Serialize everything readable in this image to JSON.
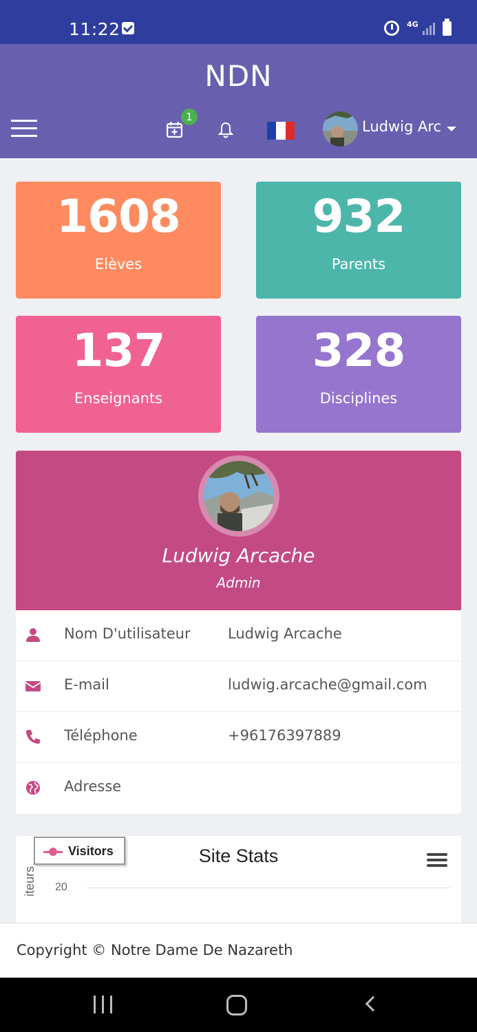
{
  "status_bar": {
    "time": "11:22",
    "network": "4G"
  },
  "header": {
    "app_title": "NDN",
    "notification_count": "1",
    "user_name": "Ludwig Arc"
  },
  "stats": [
    {
      "value": "1608",
      "label": "Elèves",
      "color": "#fd8b5f"
    },
    {
      "value": "932",
      "label": "Parents",
      "color": "#4db6ab"
    },
    {
      "value": "137",
      "label": "Enseignants",
      "color": "#f06292"
    },
    {
      "value": "328",
      "label": "Disciplines",
      "color": "#9575cd"
    }
  ],
  "profile": {
    "name": "Ludwig Arcache",
    "role": "Admin",
    "fields": [
      {
        "icon": "user-icon",
        "label": "Nom D'utilisateur",
        "value": "Ludwig Arcache"
      },
      {
        "icon": "envelope-icon",
        "label": "E-mail",
        "value": "ludwig.arcache@gmail.com"
      },
      {
        "icon": "phone-icon",
        "label": "Téléphone",
        "value": "+96176397889"
      },
      {
        "icon": "globe-icon",
        "label": "Adresse",
        "value": ""
      }
    ]
  },
  "chart_data": {
    "type": "line",
    "title": "Site Stats",
    "series": [
      {
        "name": "Visitors",
        "values": []
      }
    ],
    "yticks": [
      "20"
    ],
    "ylabel": "iteurs",
    "accent": "#e75b93"
  },
  "footer": {
    "copyright": "Copyright © Notre Dame De Nazareth"
  },
  "colors": {
    "status_bar": "#2e3d9e",
    "top_bar": "#6860ae",
    "profile_header": "#c44a84",
    "icon_accent": "#c44a84"
  }
}
